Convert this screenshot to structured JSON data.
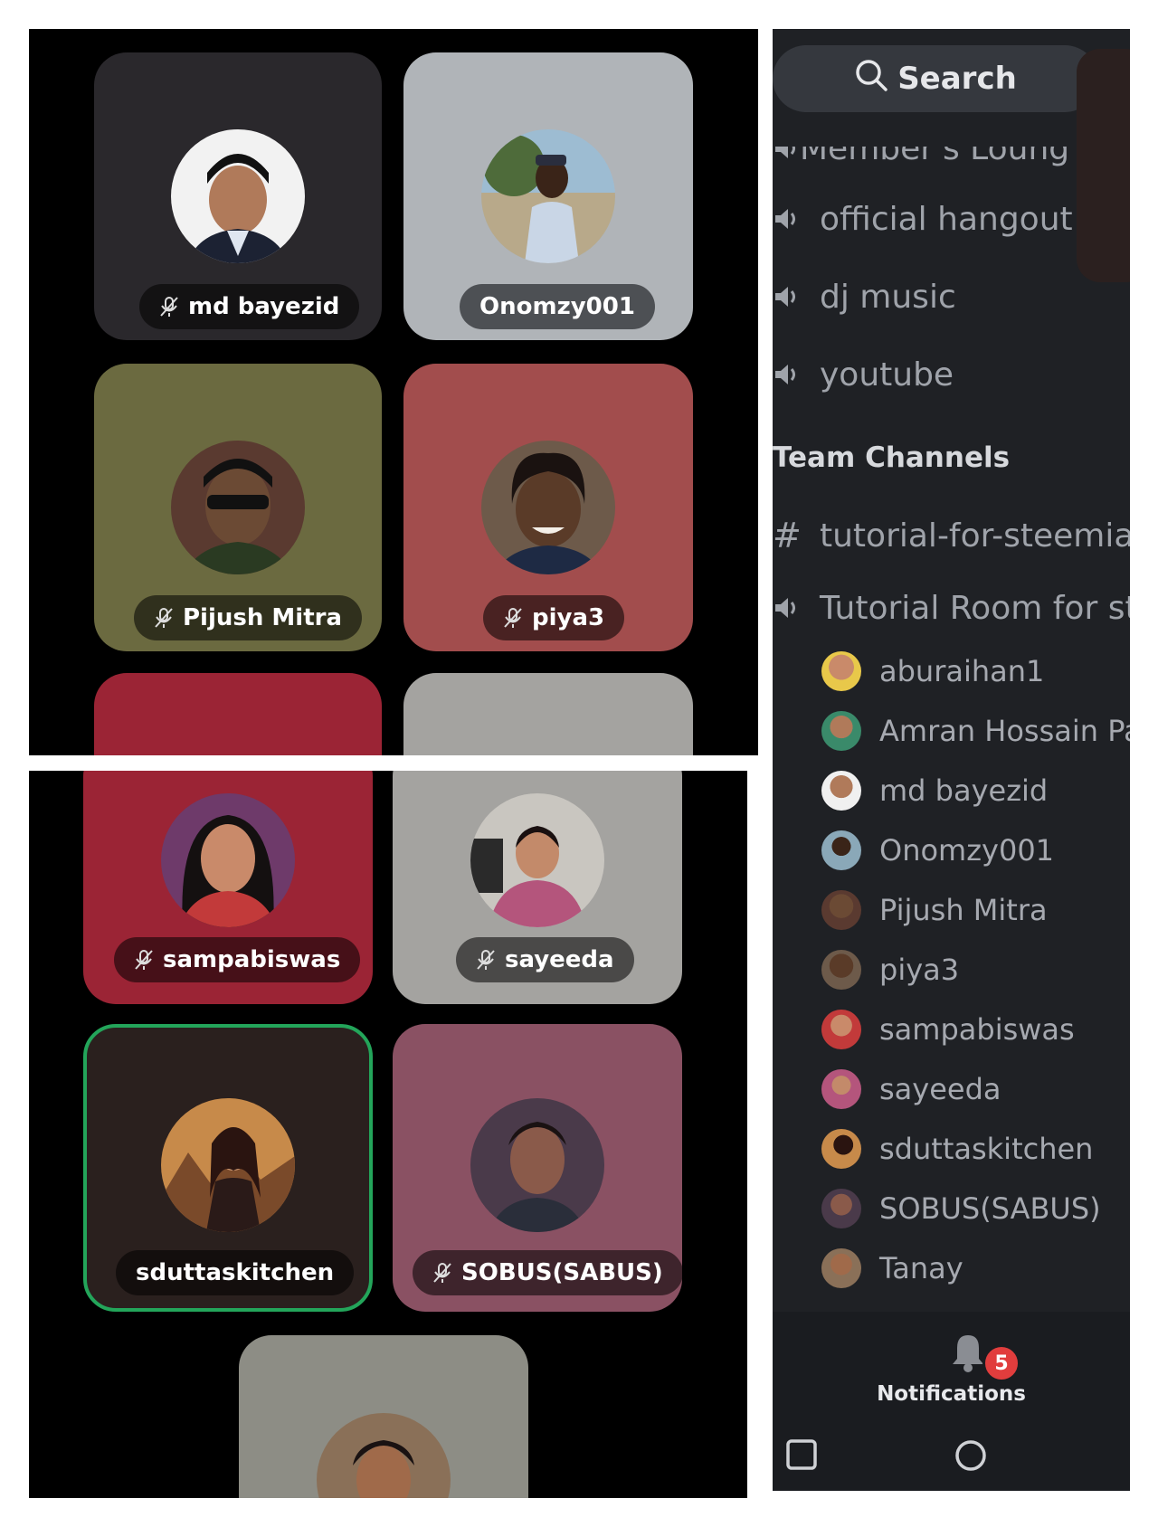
{
  "voice_grid_top": {
    "tiles": [
      {
        "name": "md bayezid",
        "muted": true,
        "bg": "#2a282c"
      },
      {
        "name": "Onomzy001",
        "muted": false,
        "bg": "#b0b4b8"
      },
      {
        "name": "Pijush Mitra",
        "muted": true,
        "bg": "#6b6a40"
      },
      {
        "name": "piya3",
        "muted": true,
        "bg": "#a24d4d"
      }
    ]
  },
  "voice_grid_bottom": {
    "tiles": [
      {
        "name": "sampabiswas",
        "muted": true,
        "bg": "#9b2435"
      },
      {
        "name": "sayeeda",
        "muted": true,
        "bg": "#a4a3a0"
      },
      {
        "name": "sduttaskitchen",
        "muted": false,
        "speaking": true,
        "bg": "#2a201e"
      },
      {
        "name": "SOBUS(SABUS)",
        "muted": true,
        "bg": "#8a5163"
      }
    ]
  },
  "sidebar": {
    "search_label": "Search",
    "voice_channels": [
      {
        "label": "Member's Lounge",
        "icon": "speaker-icon"
      },
      {
        "label": "official hangout",
        "icon": "speaker-icon"
      },
      {
        "label": "dj music",
        "icon": "speaker-icon"
      },
      {
        "label": "youtube",
        "icon": "speaker-icon"
      }
    ],
    "section_title": "Team Channels",
    "text_channel": {
      "label": "tutorial-for-steemian",
      "icon": "hash-icon"
    },
    "voice_room": {
      "label": "Tutorial Room for steemian",
      "icon": "speaker-icon"
    },
    "members": [
      "aburaihan1",
      "Amran Hossain Patwary",
      "md bayezid",
      "Onomzy001",
      "Pijush Mitra",
      "piya3",
      "sampabiswas",
      "sayeeda",
      "sduttaskitchen",
      "SOBUS(SABUS)",
      "Tanay"
    ],
    "notifications_label": "Notifications",
    "notifications_count": "5"
  }
}
